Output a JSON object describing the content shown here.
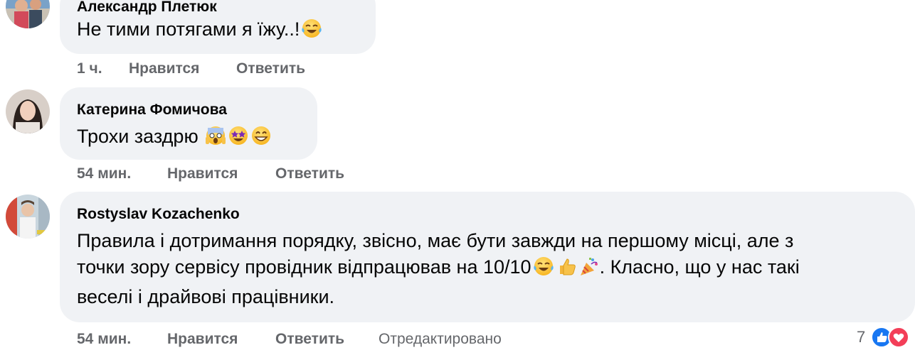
{
  "comments": [
    {
      "author": "Александр Плетюк",
      "text": "Не тими потягами я їжу..!",
      "emojis": [
        "face-with-tears-of-joy"
      ],
      "time": "1 ч.",
      "like_label": "Нравится",
      "reply_label": "Ответить"
    },
    {
      "author": "Катерина Фомичова",
      "text": "Трохи заздрю",
      "emojis": [
        "face-screaming-in-fear",
        "star-struck",
        "grinning-face"
      ],
      "time": "54 мин.",
      "like_label": "Нравится",
      "reply_label": "Ответить"
    },
    {
      "author": "Rostyslav Kozachenko",
      "text_line1": "Правила і дотримання порядку, звісно, має бути завжди на першому місці, але з",
      "text_line2a": "точки зору сервісу провідник відпрацював на 10/10",
      "text_line2b": ". Класно, що у нас такі",
      "text_line3": "веселі і драйвові працівники.",
      "emojis": [
        "face-with-tears-of-joy",
        "thumbs-up",
        "party-popper"
      ],
      "time": "54 мин.",
      "like_label": "Нравится",
      "reply_label": "Ответить",
      "edited_label": "Отредактировано",
      "reaction_count": "7",
      "reactions": [
        "like-icon",
        "love-icon"
      ]
    }
  ],
  "colors": {
    "bubble": "#f0f2f5",
    "meta": "#65676b",
    "like_blue": "#1877f2",
    "love_red": "#f33e58"
  }
}
